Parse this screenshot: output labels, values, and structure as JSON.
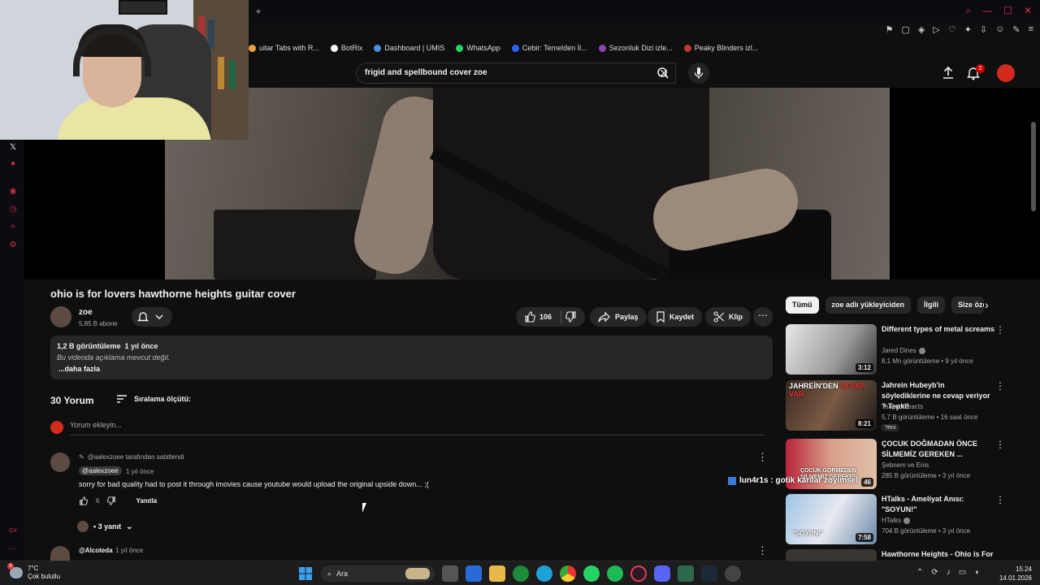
{
  "colors": {
    "bg": "#0f0f0f",
    "accent": "#cc0000",
    "gx_red": "#d4304a",
    "chip_bg": "#272727"
  },
  "bookmarks": [
    {
      "label": "uitar Tabs with R...",
      "color": "#e6a23c"
    },
    {
      "label": "BotRix",
      "color": "#ffffff"
    },
    {
      "label": "Dashboard | UMIS",
      "color": "#4a90e2"
    },
    {
      "label": "WhatsApp",
      "color": "#25d366"
    },
    {
      "label": "Cebir: Temelden İl...",
      "color": "#2962ff"
    },
    {
      "label": "Sezonluk Dizi izle...",
      "color": "#8e44ad"
    },
    {
      "label": "Peaky Blinders izl...",
      "color": "#c0392b"
    }
  ],
  "search": {
    "value": "frigid and spellbound cover zoe",
    "clear_icon": "close-icon",
    "search_icon": "search-icon",
    "mic_icon": "mic-icon"
  },
  "header": {
    "notification_count": "2"
  },
  "video": {
    "title": "ohio is for lovers hawthorne heights guitar cover",
    "channel": "zoe",
    "subscribers": "5,85 B abone",
    "likes": "106",
    "share_label": "Paylaş",
    "save_label": "Kaydet",
    "clip_label": "Klip"
  },
  "description": {
    "views": "1,2 B görüntüleme",
    "age": "1 yıl önce",
    "text": "Bu videoda açıklama mevcut değil.",
    "more": "...daha fazla"
  },
  "comments": {
    "count": "30 Yorum",
    "sort_label": "Sıralama ölçütü:",
    "add_placeholder": "Yorum ekleyin...",
    "items": [
      {
        "pinned_by": "@aalexzoee tarafından sabitlendi",
        "author": "@aalexzoee",
        "time": "1 yıl önce",
        "text": "sorry for bad quality had to post it through imovies cause youtube would upload the original upside down... ;(",
        "likes": "6",
        "reply_label": "Yanıtla",
        "replies": "• 3 yanıt"
      },
      {
        "author": "@Alcoteda",
        "time": "1 yıl önce"
      }
    ]
  },
  "chips": [
    "Tümü",
    "zoe adlı yükleyiciden",
    "İlgili",
    "Size öze"
  ],
  "recommendations": [
    {
      "title": "Different types of metal screams",
      "channel": "Jared Dines",
      "verified": true,
      "meta": "8,1 Mn görüntüleme • 9 yıl önce",
      "duration": "3:12",
      "badge": ""
    },
    {
      "title": "Jahrein Hubeyb'in söylediklerine ne cevap veriyor ? Tepki!",
      "channel": "TeapodReacts",
      "verified": false,
      "meta": "5,7 B görüntüleme • 16 saat önce",
      "duration": "8:21",
      "badge": "Yeni"
    },
    {
      "title": "ÇOCUK DOĞMADAN ÖNCE SİLMEMİZ GEREKEN ...",
      "channel": "Şebnem ve Enis",
      "verified": false,
      "meta": "285 B görüntüleme • 3 yıl önce",
      "duration": "46",
      "badge": ""
    },
    {
      "title": "HTalks - Ameliyat Anısı: \"SOYUN!\"",
      "channel": "HTalks",
      "verified": true,
      "meta": "704 B görüntüleme • 3 yıl önce",
      "duration": "7:58",
      "badge": ""
    },
    {
      "title": "Hawthorne Heights - Ohio is For",
      "channel": "",
      "verified": false,
      "meta": "",
      "duration": "",
      "badge": ""
    }
  ],
  "overlay": {
    "text": "lun4r1s : gotik karılar zoyimsel"
  },
  "taskbar": {
    "temperature": "7°C",
    "weather": "Çok bulutlu",
    "weather_badge": "6",
    "search_label": "Ara",
    "time": "15:24",
    "date": "14.01.2026"
  }
}
